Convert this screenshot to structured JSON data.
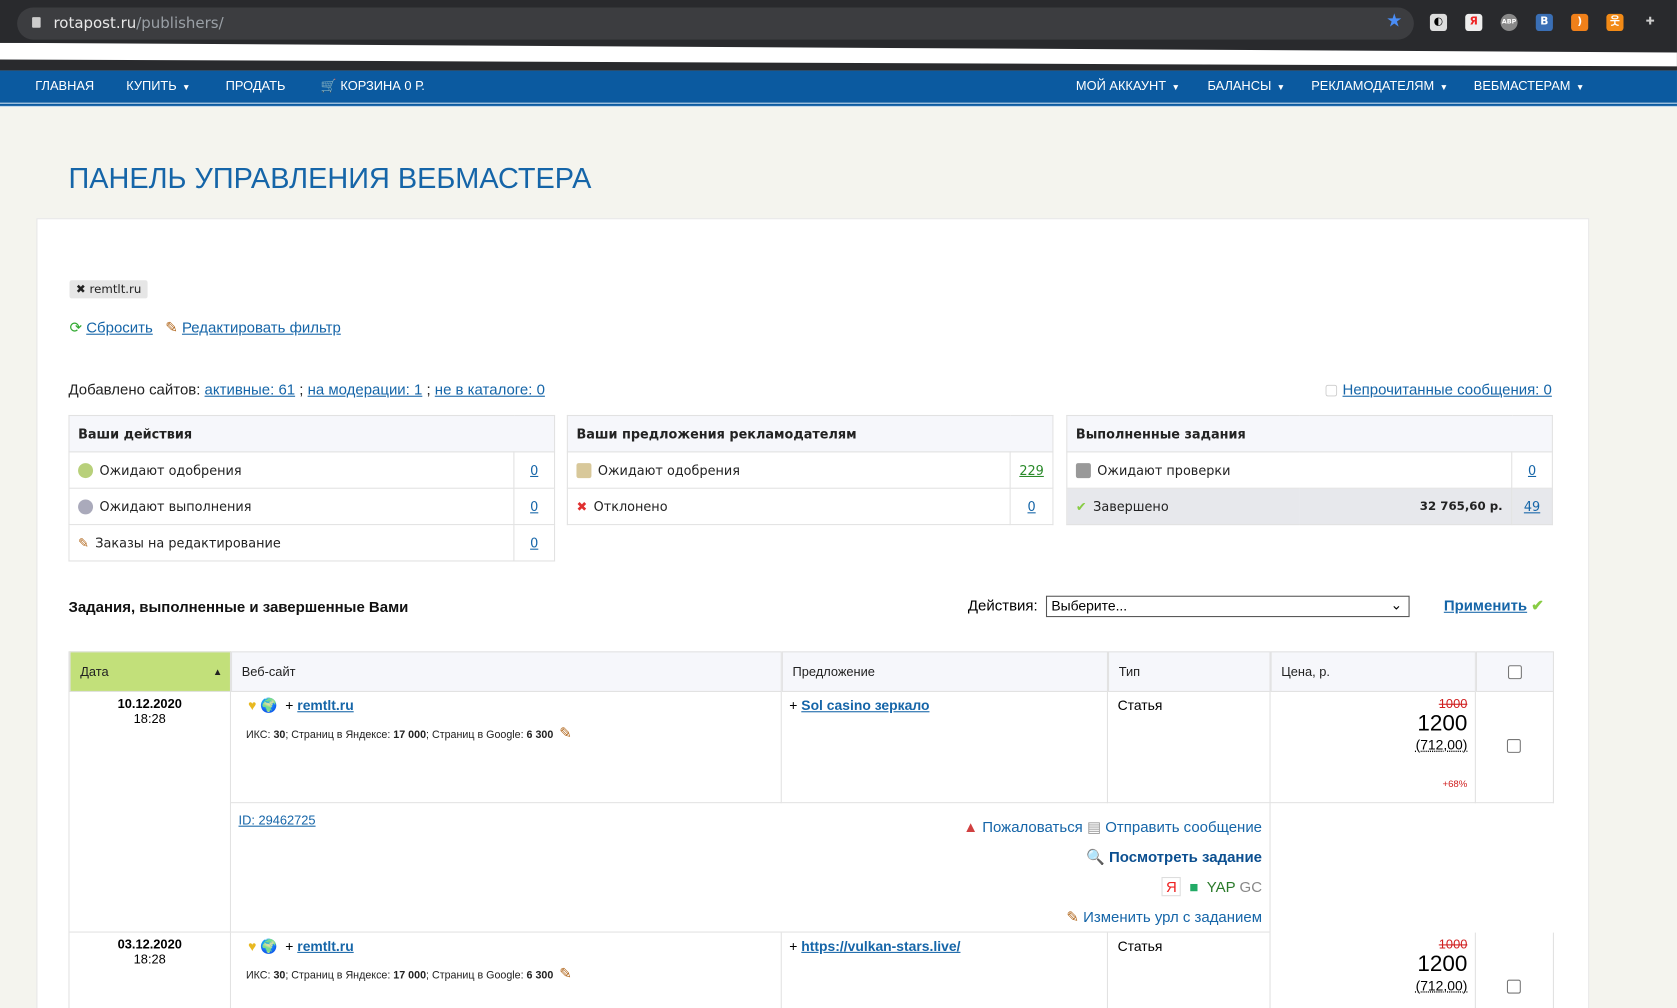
{
  "browser": {
    "url_host": "rotapost.ru",
    "url_path": "/publishers/"
  },
  "nav": {
    "left": [
      "ГЛАВНАЯ",
      "КУПИТЬ",
      "ПРОДАТЬ",
      "КОРЗИНА 0 Р."
    ],
    "right": [
      "МОЙ АККАУНТ",
      "БАЛАНСЫ",
      "РЕКЛАМОДАТЕЛЯМ",
      "ВЕБМАСТЕРАМ"
    ]
  },
  "title": "ПАНЕЛЬ УПРАВЛЕНИЯ ВЕБМАСТЕРА",
  "filter_tag": "remtlt.ru",
  "reset": "Сбросить",
  "edit_filter": "Редактировать фильтр",
  "added": {
    "label": "Добавлено сайтов:",
    "active": "активные: 61",
    "moderation": "на модерации: 1",
    "not_catalog": "не в каталоге: 0"
  },
  "unread": "Непрочитанные сообщения: 0",
  "actions_box": {
    "title": "Ваши действия",
    "rows": [
      {
        "label": "Ожидают одобрения",
        "count": "0"
      },
      {
        "label": "Ожидают выполнения",
        "count": "0"
      },
      {
        "label": "Заказы на редактирование",
        "count": "0"
      }
    ]
  },
  "offers_box": {
    "title": "Ваши предложения рекламодателям",
    "rows": [
      {
        "label": "Ожидают одобрения",
        "count": "229"
      },
      {
        "label": "Отклонено",
        "count": "0"
      }
    ]
  },
  "done_box": {
    "title": "Выполненные задания",
    "rows": [
      {
        "label": "Ожидают проверки",
        "count": "0"
      },
      {
        "label": "Завершено",
        "amount": "32 765,60 р.",
        "count": "49"
      }
    ]
  },
  "section_title": "Задания, выполненные и завершенные Вами",
  "actions_label": "Действия:",
  "select_value": "Выберите...",
  "apply": "Применить",
  "columns": [
    "Дата",
    "Веб-сайт",
    "Предложение",
    "Тип",
    "Цена, р."
  ],
  "rows": [
    {
      "date": "10.12.2020",
      "time": "18:28",
      "site": "remtlt.ru",
      "meta": [
        "ИКС: ",
        "30",
        "; Страниц в Яндексе: ",
        "17 000",
        "; Страниц в Google: ",
        "6 300"
      ],
      "offer": "Sol casino зеркало",
      "type": "Статья",
      "old_price": "1000",
      "price": "1200",
      "net": "(712,00)",
      "pct": "+68%",
      "id": "ID: 29462725",
      "complain": "Пожаловаться",
      "send": "Отправить сообщение",
      "view": "Посмотреть задание",
      "yap": "YAP",
      "gc": "GC",
      "change": "Изменить урл с заданием"
    },
    {
      "date": "03.12.2020",
      "time": "18:28",
      "site": "remtlt.ru",
      "meta": [
        "ИКС: ",
        "30",
        "; Страниц в Яндексе: ",
        "17 000",
        "; Страниц в Google: ",
        "6 300"
      ],
      "offer": "https://vulkan-stars.live/",
      "type": "Статья",
      "old_price": "1000",
      "price": "1200",
      "net": "(712,00)"
    }
  ]
}
